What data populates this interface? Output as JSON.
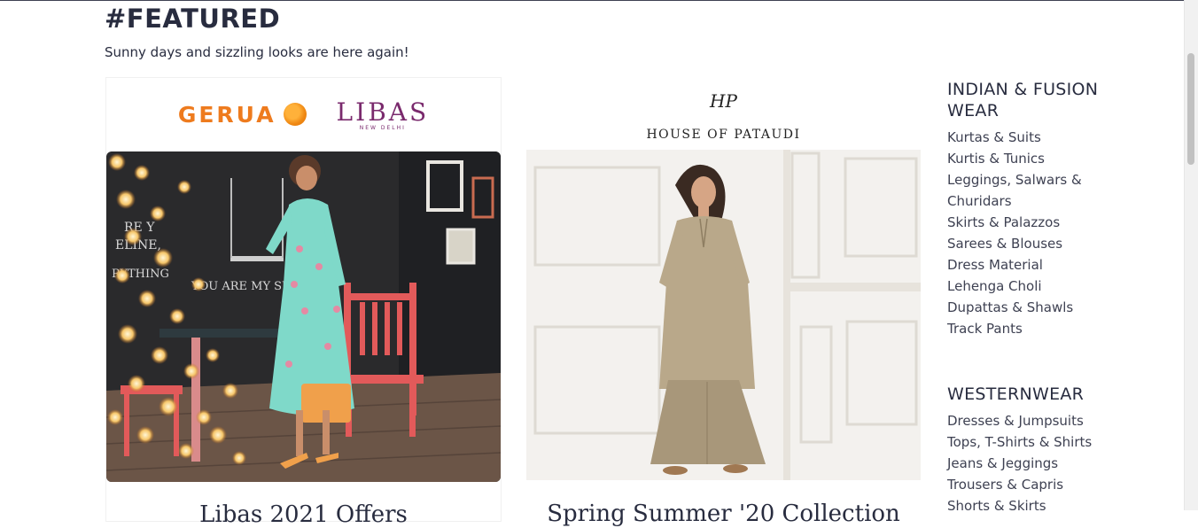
{
  "featured": {
    "title": "#FEATURED",
    "subtitle": "Sunny days and sizzling looks are here again!"
  },
  "cards": [
    {
      "brands": [
        {
          "name": "GERUA",
          "icon": "sun-icon",
          "color": "#ee7b1e"
        },
        {
          "name": "LIBAS",
          "tagline": "NEW DELHI",
          "color": "#7a2a6d"
        }
      ],
      "image": "woman-in-mint-floral-dress-photo",
      "caption": "Libas 2021 Offers"
    },
    {
      "brands": [
        {
          "name": "HOUSE OF PATAUDI",
          "mark": "HP"
        }
      ],
      "image": "woman-in-beige-kurta-photo",
      "caption": "Spring Summer '20 Collection"
    }
  ],
  "categories": [
    {
      "heading": "INDIAN & FUSION WEAR",
      "items": [
        "Kurtas & Suits",
        "Kurtis & Tunics",
        "Leggings, Salwars & Churidars",
        "Skirts & Palazzos",
        "Sarees & Blouses",
        "Dress Material",
        "Lehenga Choli",
        "Dupattas & Shawls",
        "Track Pants"
      ]
    },
    {
      "heading": "WESTERNWEAR",
      "items": [
        "Dresses & Jumpsuits",
        "Tops, T-Shirts & Shirts",
        "Jeans & Jeggings",
        "Trousers & Capris",
        "Shorts & Skirts"
      ]
    }
  ],
  "colors": {
    "text": "#282c3f",
    "gerua_orange": "#ee7b1e",
    "libas_purple": "#7a2a6d",
    "dress_mint": "#7fd9c9"
  }
}
